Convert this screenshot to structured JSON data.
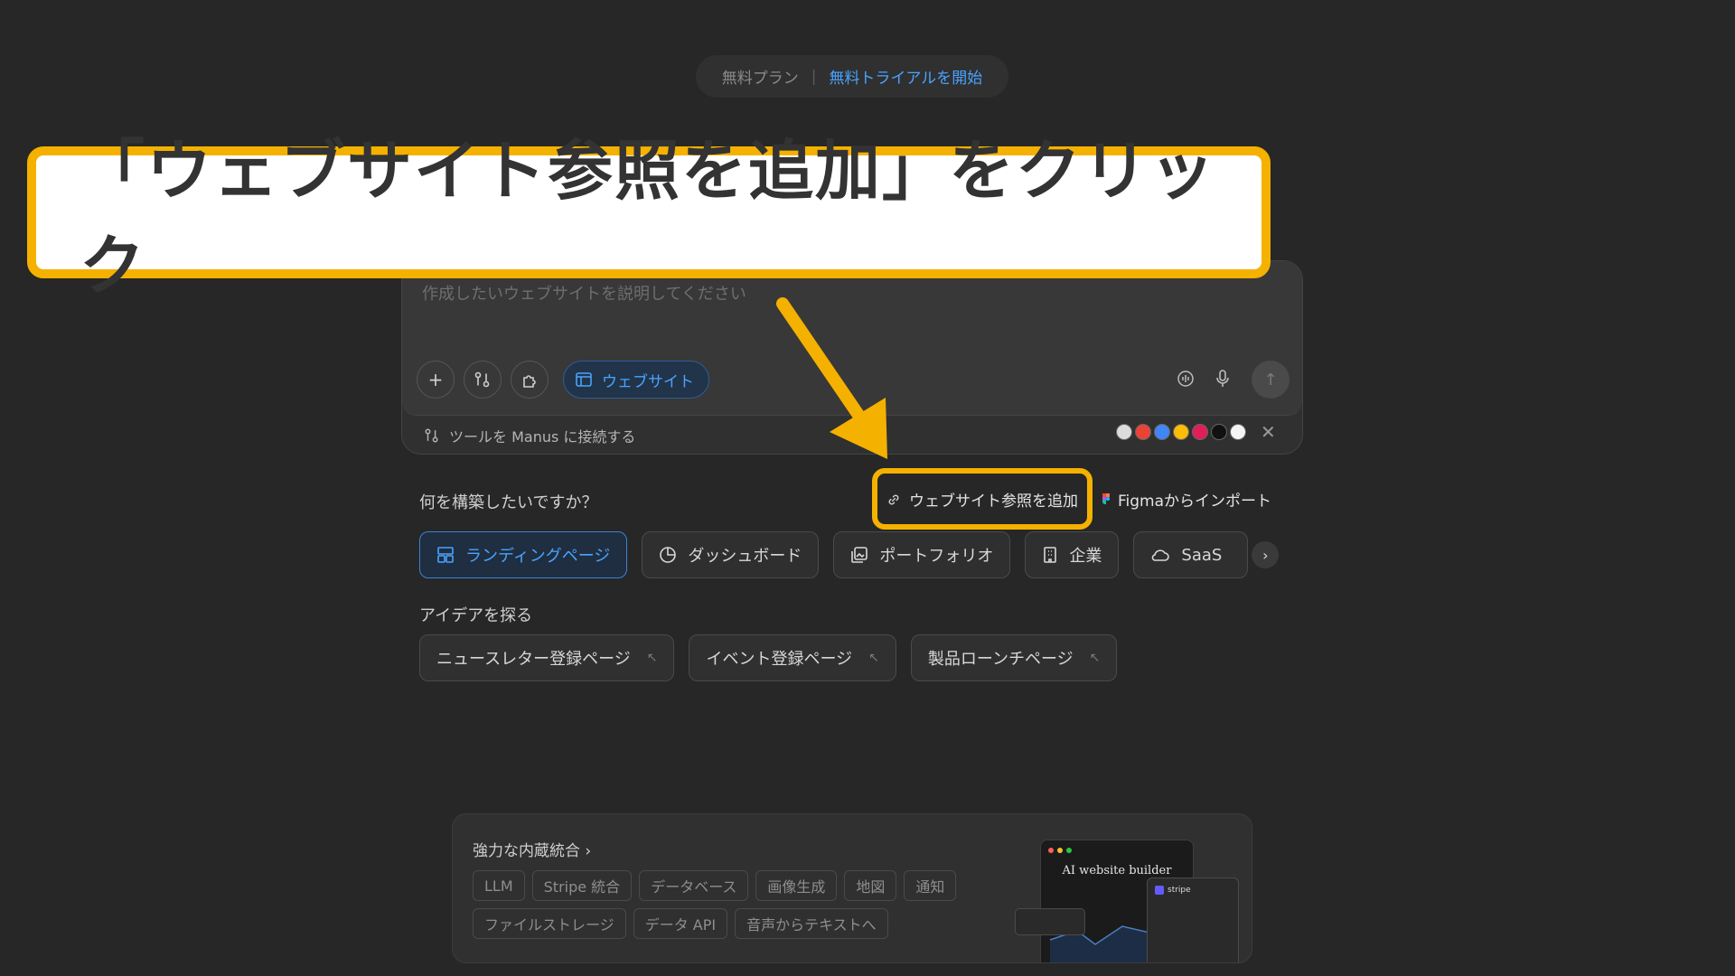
{
  "plan": {
    "free_label": "無料プラン",
    "separator": "|",
    "trial_label": "無料トライアルを開始"
  },
  "composer": {
    "placeholder": "作成したいウェブサイトを説明してください",
    "website_chip_label": "ウェブサイト",
    "connect_label": "ツールを Manus に接続する"
  },
  "section": {
    "question": "何を構築したいですか？",
    "add_reference_label": "ウェブサイト参照を追加",
    "figma_import_label": "Figmaからインポート"
  },
  "categories": [
    {
      "label": "ランディングページ",
      "icon": "layout-icon"
    },
    {
      "label": "ダッシュボード",
      "icon": "pie-chart-icon"
    },
    {
      "label": "ポートフォリオ",
      "icon": "image-gallery-icon"
    },
    {
      "label": "企業",
      "icon": "building-icon"
    },
    {
      "label": "SaaS",
      "icon": "cloud-icon"
    }
  ],
  "ideas": {
    "label": "アイデアを探る",
    "items": [
      "ニュースレター登録ページ",
      "イベント登録ページ",
      "製品ローンチページ"
    ]
  },
  "integrations": {
    "title": "強力な内蔵統合",
    "tags": [
      "LLM",
      "Stripe 統合",
      "データベース",
      "画像生成",
      "地図",
      "通知",
      "ファイルストレージ",
      "データ API",
      "音声からテキストへ"
    ],
    "preview_title": "AI website builder",
    "preview_badge": "stripe"
  },
  "annotation": {
    "text": "「ウェブサイト参照を追加」をクリック"
  },
  "colors": {
    "accent": "#4aa3ff",
    "callout_border": "#f5b100",
    "background": "#272727"
  }
}
